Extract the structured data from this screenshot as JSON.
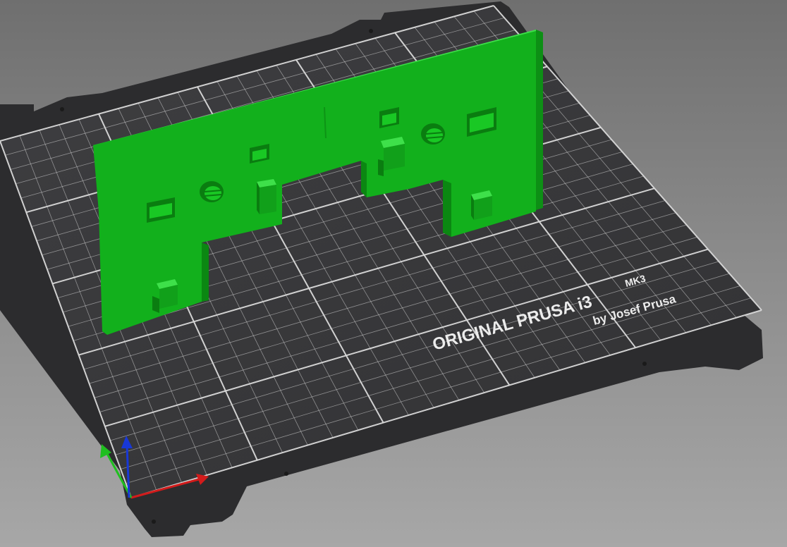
{
  "viewport": {
    "background_top": "#6f6f6f",
    "background_bottom": "#a7a7a7"
  },
  "bed": {
    "model": "ORIGINAL PRUSA i3",
    "variant": "MK3",
    "credit": "by Josef Prusa",
    "plate_color": "#3a3a3c",
    "frame_color": "#2b2b2d",
    "grid_color": "#d9d9d9"
  },
  "part": {
    "color": "#10b21a",
    "edge_color": "#3ee04a"
  },
  "axes": {
    "x_color": "#d21b1b",
    "y_color": "#1fbf1f",
    "z_color": "#1838d8"
  }
}
